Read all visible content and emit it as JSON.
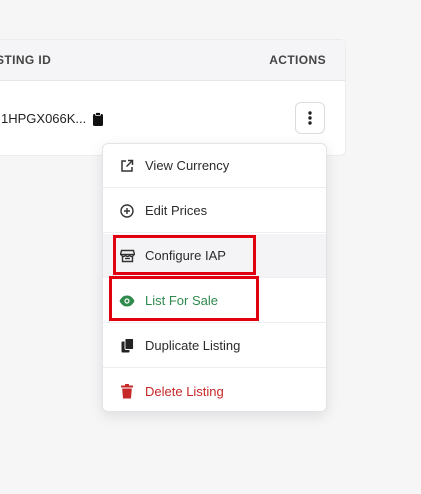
{
  "table": {
    "col_listing_id": "STING ID",
    "col_actions": "ACTIONS",
    "row": {
      "listing_id": "1HPGX066K..."
    }
  },
  "menu": {
    "items": [
      {
        "label": "View Currency",
        "icon": "external-link-icon"
      },
      {
        "label": "Edit Prices",
        "icon": "plus-circle-icon"
      },
      {
        "label": "Configure IAP",
        "icon": "store-icon"
      },
      {
        "label": "List For Sale",
        "icon": "eye-icon"
      },
      {
        "label": "Duplicate Listing",
        "icon": "copy-icon"
      },
      {
        "label": "Delete Listing",
        "icon": "trash-icon"
      }
    ]
  },
  "colors": {
    "green": "#2f8a4c",
    "red": "#c62828",
    "annotation": "#e0000f"
  }
}
